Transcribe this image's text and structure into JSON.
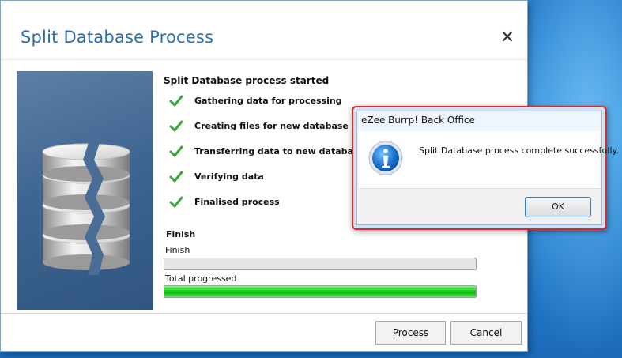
{
  "window": {
    "title": "Split Database Process",
    "close_glyph": "✕"
  },
  "side_image": {
    "icon": "database-split-icon"
  },
  "process": {
    "heading": "Split Database process started",
    "steps": [
      {
        "label": "Gathering data for processing",
        "status": "done"
      },
      {
        "label": "Creating files for new database",
        "status": "done"
      },
      {
        "label": "Transferring data to new database",
        "status": "done"
      },
      {
        "label": "Verifying data",
        "status": "done"
      },
      {
        "label": "Finalised process",
        "status": "done"
      }
    ],
    "finish_title": "Finish",
    "finish_bar_label": "Finish",
    "finish_progress": 0,
    "total_label": "Total progressed",
    "total_progress": 1.0
  },
  "buttons": {
    "process": "Process",
    "cancel": "Cancel"
  },
  "dialog": {
    "title": "eZee Burrp! Back Office",
    "message": "Split Database process complete successfully.",
    "icon": "info-icon",
    "ok": "OK"
  },
  "colors": {
    "title": "#2a6fb0",
    "check": "#3aa63a",
    "progress": "#1fd41f",
    "dialog_border": "#d82a2a"
  }
}
